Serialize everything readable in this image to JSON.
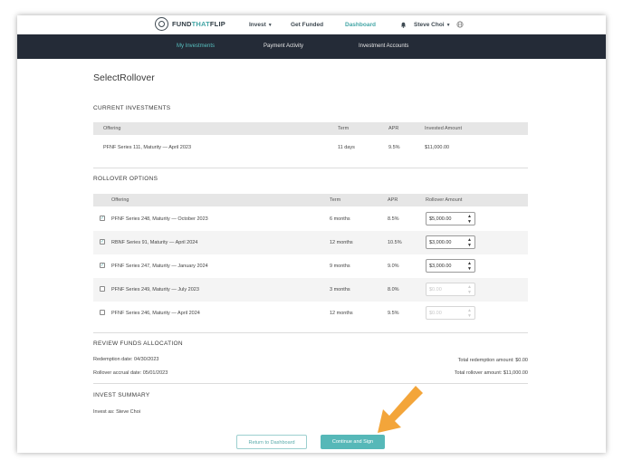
{
  "header": {
    "brand_part1": "FUND",
    "brand_part2": "THAT",
    "brand_part3": "FLIP",
    "nav": [
      "Invest",
      "Get Funded",
      "Dashboard"
    ],
    "user": "Steve Choi",
    "accent_color": "#44a6a6"
  },
  "subnav": [
    "My Investments",
    "Payment Activity",
    "Investment Accounts"
  ],
  "page_title": "SelectRollover",
  "current": {
    "title": "CURRENT INVESTMENTS",
    "headers": [
      "Offering",
      "Term",
      "APR",
      "Invested Amount"
    ],
    "rows": [
      {
        "offering": "PFNF Series 111, Maturity — April 2023",
        "term": "11 days",
        "apr": "9.5%",
        "amount": "$11,000.00"
      }
    ]
  },
  "rollover": {
    "title": "ROLLOVER OPTIONS",
    "headers": [
      "Offering",
      "Term",
      "APR",
      "Rollover Amount"
    ],
    "rows": [
      {
        "checked": true,
        "offering": "PFNF Series 248, Maturity — October 2023",
        "term": "6 months",
        "apr": "8.5%",
        "amount": "$5,000.00"
      },
      {
        "checked": true,
        "offering": "RBNF Series 91, Maturity — April 2024",
        "term": "12 months",
        "apr": "10.5%",
        "amount": "$3,000.00"
      },
      {
        "checked": true,
        "offering": "PFNF Series 247, Maturity — January 2024",
        "term": "9 months",
        "apr": "9.0%",
        "amount": "$3,000.00"
      },
      {
        "checked": false,
        "offering": "PFNF Series 249, Maturity — July 2023",
        "term": "3 months",
        "apr": "8.0%",
        "amount": "$0.00"
      },
      {
        "checked": false,
        "offering": "PFNF Series 246, Maturity — April 2024",
        "term": "12 months",
        "apr": "9.5%",
        "amount": "$0.00"
      }
    ]
  },
  "review": {
    "title": "REVIEW FUNDS ALLOCATION",
    "redemption_date": "Redemption date:  04/30/2023",
    "accrual_date": "Rollover accrual date: 05/01/2023",
    "total_redemption": "Total redemption amount:  $0.00",
    "total_rollover": "Total rollover amount:  $11,000.00"
  },
  "summary": {
    "title": "INVEST SUMMARY",
    "invest_as": "Invest as: Steve Choi"
  },
  "buttons": {
    "return": "Return to Dashboard",
    "continue": "Continue and Sign"
  },
  "arrow_color": "#f3a53a"
}
